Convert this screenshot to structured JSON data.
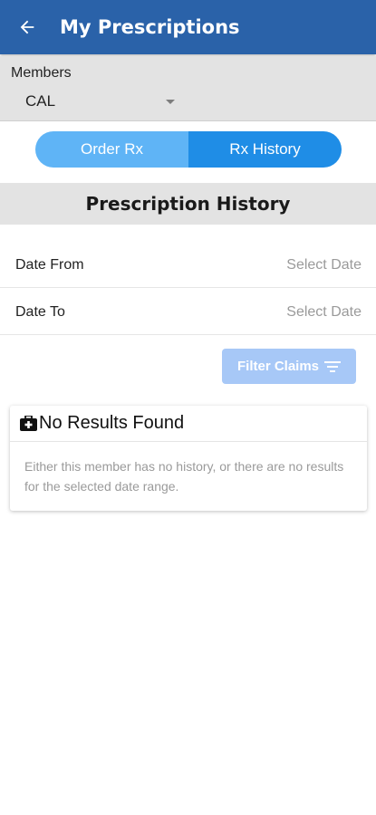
{
  "app_bar": {
    "title": "My Prescriptions",
    "color": "#2a62a9",
    "back_icon": "arrow-left-icon"
  },
  "members": {
    "label": "Members",
    "selected": "CAL"
  },
  "tabs": [
    {
      "label": "Order Rx",
      "active": false
    },
    {
      "label": "Rx History",
      "active": true
    }
  ],
  "section": {
    "title": "Prescription History"
  },
  "dates": {
    "from": {
      "label": "Date From",
      "value": "Select Date"
    },
    "to": {
      "label": "Date To",
      "value": "Select Date"
    }
  },
  "filter": {
    "label": "Filter Claims",
    "icon": "filter-lines-icon"
  },
  "empty_state": {
    "icon": "medical-kit-icon",
    "title": "No Results Found",
    "message": "Either this member has no history, or there are no results for the selected date range."
  }
}
